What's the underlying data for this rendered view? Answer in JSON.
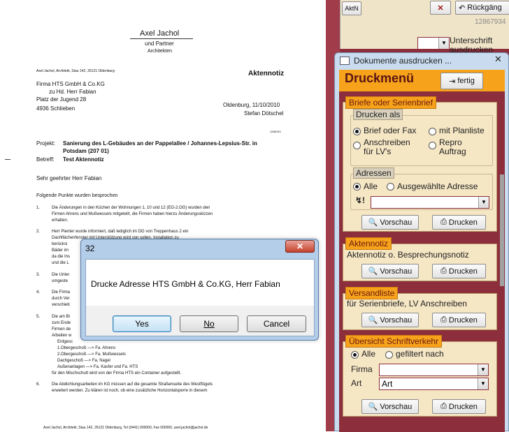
{
  "document": {
    "letterhead_name": "Axel Jachol",
    "letterhead_sub1": "und Partner",
    "letterhead_sub2": "Architekten",
    "sender_line": "Axel Jachol, Architekt, Stau 142, 26121 Oldenburg",
    "doc_type": "Aktennotiz",
    "addr1": "Firma HTS GmbH & Co.KG",
    "addr2": "zu Hd. Herr Fabian",
    "addr3": "Platz der Jugend 28",
    "addr4": "4936 Schlieben",
    "date_line": "Oldenburg, 11/10/2010",
    "author": "Stefan Dötschel",
    "ref_number": "1286763",
    "project_label": "Projekt:",
    "project_text1": "Sanierung des L-Gebäudes an der Pappelallee / Johannes-Lepsius-Str. in",
    "project_text2": "Potsdam (207 01)",
    "subject_label": "Betreff:",
    "subject_text": "Test Aktennotiz",
    "salutation": "Sehr geehrter Herr Fabian",
    "intro": "Folgende Punkte wurden besprochen",
    "p1_num": "1.",
    "p1_l1": "Die Änderungen in den Küchen der Wohnungen 1, 10 und 12 (EG-2.OG) wurden den",
    "p1_l2": "Firmen Ahrens und Mußwessels mitgeteilt, die Firmen haben hierzu Änderungsskizzen",
    "p1_l3": "erhalten.",
    "p2_num": "2.",
    "p2_l1": "Herr Pienter wurde informiert, daß lediglich im DG von Treppenhaus 2 ein",
    "p2_l2": "Dachflächenfenster mit Unterstützung wird von sollen. Installation zu",
    "p2_l3": "berücksi",
    "p2_l4": "Bäder im",
    "p2_l5": "da die Ins",
    "p2_l6": "und die L",
    "p3_num": "3.",
    "p3_l1": "Die Unter",
    "p3_l2": "umgeste",
    "p4_num": "4.",
    "p4_l1": "Die Firma",
    "p4_l2": "durch Ver",
    "p4_l3": "verschieb",
    "p5_num": "5.",
    "p5_l1": "Die am Bi",
    "p5_l2": "zum Ende",
    "p5_l3": "Firmen de",
    "p5_l4": "Arbeiten w",
    "p5_l5": "Erdgesc",
    "p5_l6": "1.Obergeschoß —> Fa. Ahrens",
    "p5_l7": "2.Obergeschoß —> Fa. Mußwessels",
    "p5_l8": "Dachgeschoß —> Fa. Nagel",
    "p5_l9": "Außenanlagen —> Fa. Kasfer und Fa. HTS",
    "p5_l10": "für den Mischschutt wird von der Firma HTS ein Container aufgestellt.",
    "p6_num": "6.",
    "p6_l1": "Die Abdichtungsarbeiten im KG müssen auf die gesamte Straßenseite des Westflügels",
    "p6_l2": "erweitert werden. Zu klären ist noch, ob eine zusätzliche Horizontalsperre in diesem",
    "footer": "Axel Jachol, Architekt, Stau 142, 26121 Oldenburg, Tel (0441) 000000, Fax 000000, axel.jachol@jachol.de"
  },
  "access_top": {
    "aktn_button": "AktN",
    "back_button": "Rückgäng",
    "record_number": "12867934",
    "unterschrift_label": "Unterschrift",
    "unterschrift_sub": "ausdrucken"
  },
  "druck_window": {
    "title": "Dokumente ausdrucken ...",
    "heading": "Druckmenü",
    "fertig_button": "fertig",
    "section1_label": "Briefe oder Serienbrief",
    "drucken_als_label": "Drucken als",
    "opt_brief": "Brief oder Fax",
    "opt_planliste": "mit Planliste",
    "opt_anschreiben_1": "Anschreiben",
    "opt_anschreiben_2": "für LV's",
    "opt_repro_1": "Repro",
    "opt_repro_2": "Auftrag",
    "adressen_label": "Adressen",
    "opt_alle": "Alle",
    "opt_ausgewaehlte": "Ausgewählte Adresse",
    "vorschau_button": "Vorschau",
    "drucken_button": "Drucken",
    "section2_label": "Aktennotiz",
    "aktennotiz_text": "Aktennotiz o. Besprechungsnotiz",
    "section3_label": "Versandliste",
    "versandliste_text": "für Serienbriefe, LV Anschreiben",
    "section4_label": "Übersicht Schriftverkehr",
    "opt_alle2": "Alle",
    "opt_gefiltert": "gefiltert nach",
    "firma_label": "Firma",
    "art_label": "Art",
    "art_value": "Art"
  },
  "dialog": {
    "title": "32",
    "message": "Drucke Adresse HTS GmbH & Co.KG, Herr Fabian",
    "yes_button": "Yes",
    "no_button": "No",
    "cancel_button": "Cancel"
  },
  "colors": {
    "access_bg": "#8c2e3c",
    "panel_bg": "#f5e6c4",
    "section_label_bg": "#f7a21b",
    "window_frame": "#c9dcef"
  }
}
